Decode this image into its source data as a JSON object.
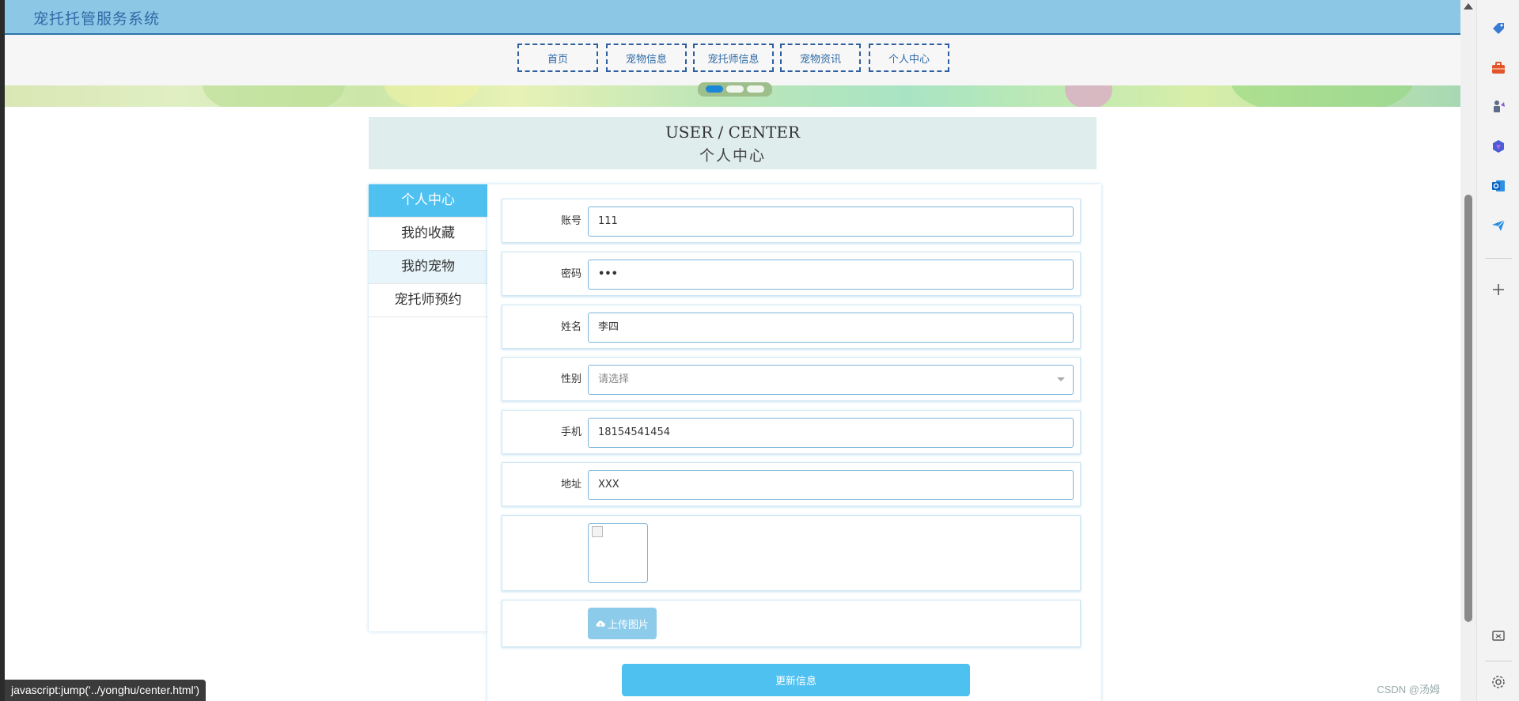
{
  "site": {
    "title": "宠托托管服务系统"
  },
  "nav": {
    "items": [
      {
        "label": "首页"
      },
      {
        "label": "宠物信息"
      },
      {
        "label": "宠托师信息"
      },
      {
        "label": "宠物资讯"
      },
      {
        "label": "个人中心"
      }
    ]
  },
  "carousel": {
    "slide_count": 3,
    "active_index": 0
  },
  "header": {
    "title_en": "USER / CENTER",
    "title_cn": "个人中心"
  },
  "sidebar": {
    "items": [
      {
        "label": "个人中心",
        "active": true
      },
      {
        "label": "我的收藏"
      },
      {
        "label": "我的宠物",
        "hovered": true
      },
      {
        "label": "宠托师预约"
      }
    ]
  },
  "form": {
    "account": {
      "label": "账号",
      "value": "111"
    },
    "password": {
      "label": "密码",
      "value": "•••"
    },
    "name": {
      "label": "姓名",
      "value": "李四"
    },
    "gender": {
      "label": "性别",
      "placeholder": "请选择"
    },
    "phone": {
      "label": "手机",
      "value": "18154541454"
    },
    "address": {
      "label": "地址",
      "value": "XXX"
    },
    "upload_label": "上传图片",
    "submit_label": "更新信息"
  },
  "status_bar": {
    "text": "javascript:jump('../yonghu/center.html')"
  },
  "watermark": "CSDN @汤姆",
  "colors": {
    "topbar": "#8cc7e6",
    "accent": "#4fc1f0",
    "nav_border": "#2f5f9e",
    "upload": "#8ccbea"
  },
  "edge_sidebar": {
    "icons": [
      "tag-icon",
      "briefcase-icon",
      "chess-icon",
      "copilot-icon",
      "outlook-icon",
      "send-icon",
      "add-icon",
      "screenshot-icon",
      "settings-icon"
    ]
  }
}
